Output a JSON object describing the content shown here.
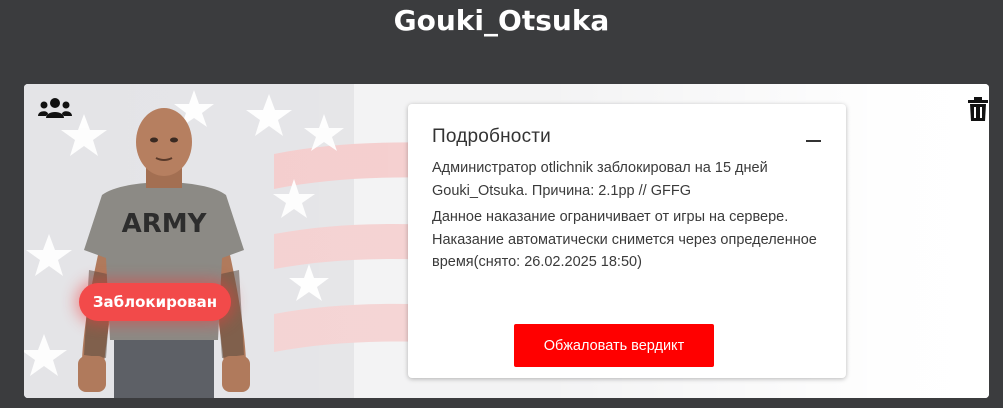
{
  "header": {
    "title": "Gouki_Otsuka"
  },
  "card": {
    "avatar": {
      "shirt_text": "ARMY"
    },
    "status_badge": "Заблокирован",
    "details": {
      "title": "Подробности",
      "paragraph1": "Администратор otlichnik заблокировал на 15 дней Gouki_Otsuka. Причина: 2.1pp // GFFG",
      "paragraph2": "Данное наказание ограничивает от игры на сервере. Наказание автоматически снимется через определенное время(снято: 26.02.2025 18:50)",
      "appeal_button": "Обжаловать вердикт"
    },
    "icons": {
      "left": "group-icon",
      "right": "trash-icon",
      "collapse": "minus-icon"
    }
  },
  "colors": {
    "page_bg": "#3b3c3e",
    "badge": "#f24a4a",
    "appeal": "#ff0000"
  }
}
